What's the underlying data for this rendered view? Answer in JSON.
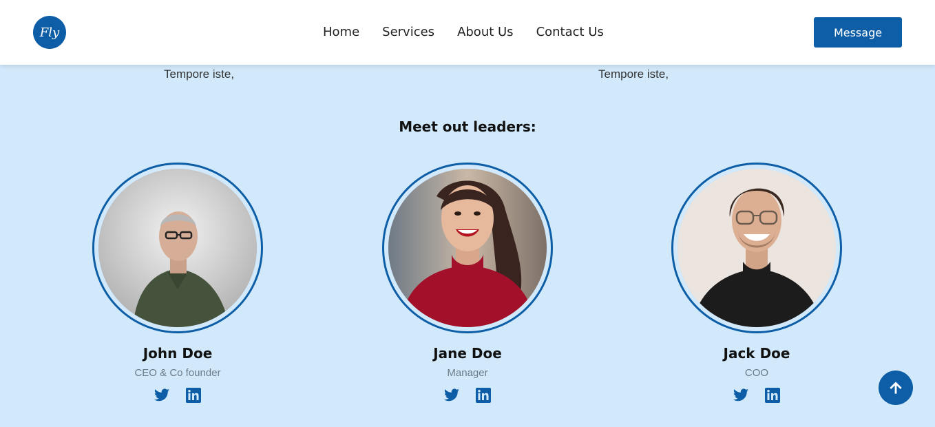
{
  "header": {
    "logo_text": "Fly",
    "nav": [
      "Home",
      "Services",
      "About Us",
      "Contact Us"
    ],
    "message_button": "Message"
  },
  "previous_section": {
    "text_left": "Tempore iste,",
    "text_right": "Tempore iste,"
  },
  "leaders": {
    "title": "Meet out leaders:",
    "people": [
      {
        "name": "John Doe",
        "role": "CEO & Co founder"
      },
      {
        "name": "Jane Doe",
        "role": "Manager"
      },
      {
        "name": "Jack Doe",
        "role": "COO"
      }
    ]
  },
  "icons": {
    "twitter": "twitter-icon",
    "linkedin": "linkedin-icon",
    "scroll_top": "arrow-up-icon"
  },
  "colors": {
    "brand": "#0d5ea6",
    "background": "#d1e9fb",
    "header_bg": "#ffffff"
  }
}
